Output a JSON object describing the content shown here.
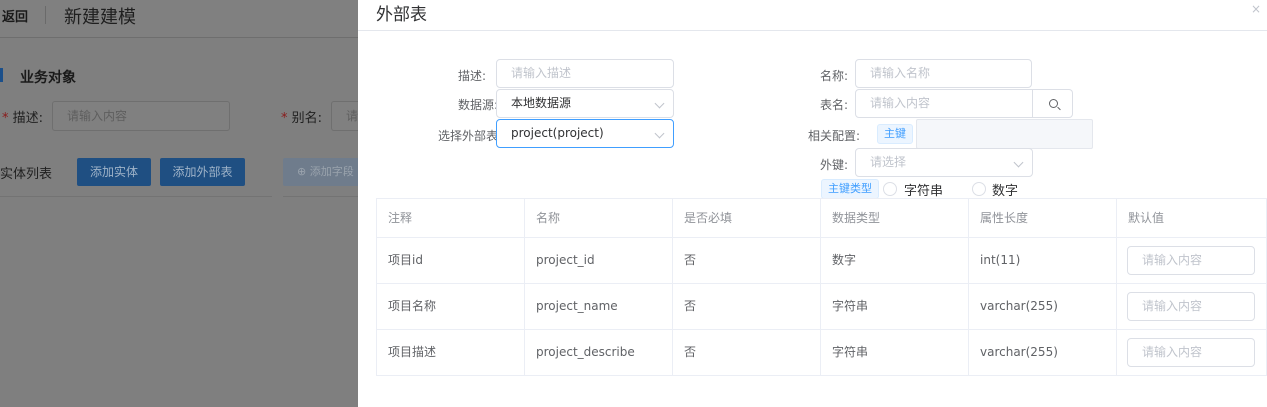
{
  "background": {
    "back_label": "返回",
    "page_title": "新建建模",
    "section_title": "业务对象",
    "desc_label": "描述:",
    "desc_placeholder": "请输入内容",
    "alias_label": "别名:",
    "alias_placeholder": "请",
    "entity_list_label": "实体列表",
    "add_entity_btn": "添加实体",
    "add_external_btn": "添加外部表",
    "add_field_btn": "添加字段",
    "required_mark": "*"
  },
  "drawer": {
    "title": "外部表",
    "close_icon": "close-icon",
    "form": {
      "desc_label": "描述:",
      "desc_placeholder": "请输入描述",
      "datasource_label": "数据源:",
      "datasource_value": "本地数据源",
      "external_table_label": "选择外部表:",
      "external_table_value": "project(project)",
      "name_label": "名称:",
      "name_placeholder": "请输入名称",
      "table_name_label": "表名:",
      "table_name_placeholder": "请输入内容",
      "related_config_label": "相关配置:",
      "primary_key_tag": "主键",
      "foreign_key_label": "外键:",
      "foreign_key_placeholder": "请选择",
      "pk_type_tag": "主键类型",
      "pk_type_options": [
        "字符串",
        "数字"
      ]
    },
    "table": {
      "columns": [
        "注释",
        "名称",
        "是否必填",
        "数据类型",
        "属性长度",
        "默认值"
      ],
      "default_placeholder": "请输入内容",
      "rows": [
        {
          "comment": "项目id",
          "name": "project_id",
          "required": "否",
          "type": "数字",
          "length": "int(11)"
        },
        {
          "comment": "项目名称",
          "name": "project_name",
          "required": "否",
          "type": "字符串",
          "length": "varchar(255)"
        },
        {
          "comment": "项目描述",
          "name": "project_describe",
          "required": "否",
          "type": "字符串",
          "length": "varchar(255)"
        }
      ]
    }
  }
}
